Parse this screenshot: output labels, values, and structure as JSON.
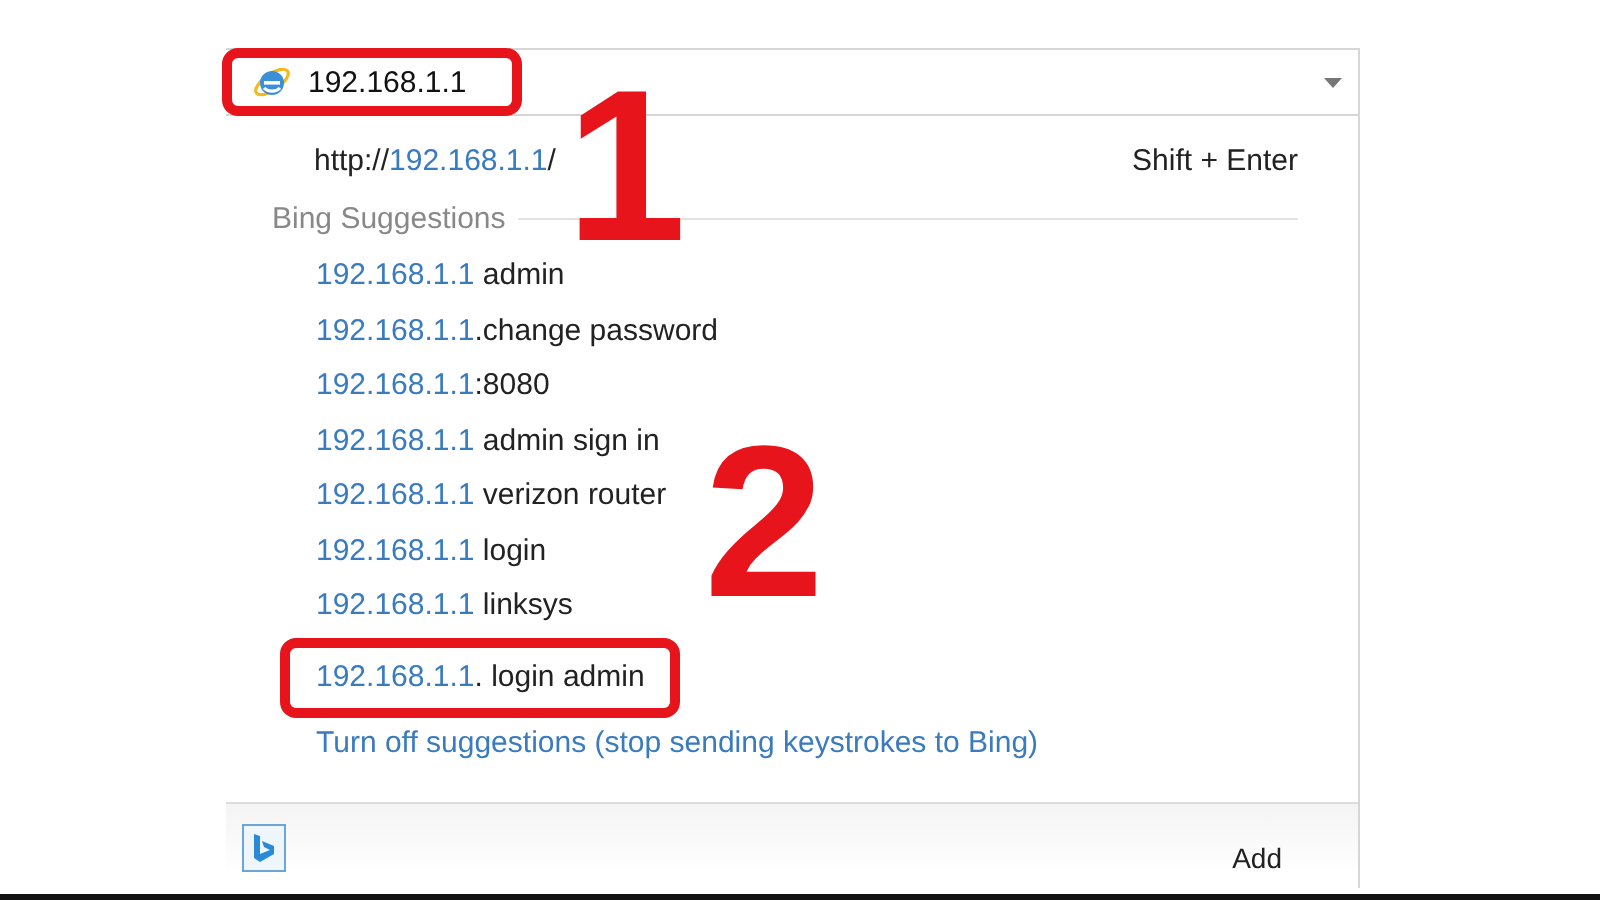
{
  "address_bar": {
    "value": "192.168.1.1",
    "highlighted": true
  },
  "go_entry": {
    "scheme": "http://",
    "host": "192.168.1.1",
    "tail": "/",
    "shortcut": "Shift + Enter"
  },
  "section_title": "Bing Suggestions",
  "suggestions": [
    {
      "prefix": "192.168.1.1",
      "rest": " admin",
      "highlighted": false
    },
    {
      "prefix": "192.168.1.1",
      "rest": ".change password",
      "highlighted": false
    },
    {
      "prefix": "192.168.1.1",
      "rest": ":8080",
      "highlighted": false
    },
    {
      "prefix": "192.168.1.1",
      "rest": " admin sign in",
      "highlighted": false
    },
    {
      "prefix": "192.168.1.1",
      "rest": " verizon router",
      "highlighted": false
    },
    {
      "prefix": "192.168.1.1",
      "rest": " login",
      "highlighted": false
    },
    {
      "prefix": "192.168.1.1",
      "rest": " linksys",
      "highlighted": false
    },
    {
      "prefix": "192.168.1.1",
      "rest": ". login admin",
      "highlighted": true
    }
  ],
  "turn_off_link": "Turn off suggestions (stop sending keystrokes to Bing)",
  "footer": {
    "add_label": "Add"
  },
  "callouts": [
    {
      "label": "1"
    },
    {
      "label": "2"
    }
  ]
}
